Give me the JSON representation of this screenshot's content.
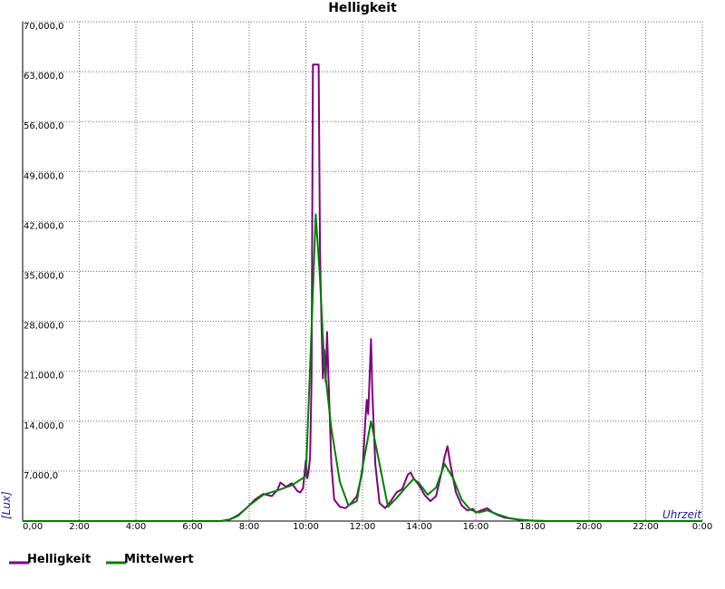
{
  "chart_data": {
    "type": "line",
    "title": "Helligkeit",
    "xlabel": "Uhrzeit",
    "ylabel": "[Lux]",
    "x_tick_labels": [
      "0,00",
      "2:00",
      "4:00",
      "6:00",
      "8:00",
      "10:00",
      "12:00",
      "14:00",
      "16:00",
      "18:00",
      "20:00",
      "22:00",
      "0:00"
    ],
    "y_tick_labels": [
      "7,000,0",
      "14,000,0",
      "21,000,0",
      "28,000,0",
      "35,000,0",
      "42,000,0",
      "49,000,0",
      "56,000,0",
      "63,000,0",
      "70,000,0"
    ],
    "xlim": [
      0,
      24
    ],
    "ylim": [
      0,
      70000
    ],
    "grid": true,
    "legend_position": "bottom-left",
    "series": [
      {
        "name": "Helligkeit",
        "color": "#800080",
        "points": [
          [
            0,
            0
          ],
          [
            7.0,
            0
          ],
          [
            7.3,
            200
          ],
          [
            7.6,
            800
          ],
          [
            7.9,
            1800
          ],
          [
            8.2,
            3000
          ],
          [
            8.5,
            3800
          ],
          [
            8.8,
            3500
          ],
          [
            9.0,
            4400
          ],
          [
            9.1,
            5400
          ],
          [
            9.3,
            4800
          ],
          [
            9.5,
            5300
          ],
          [
            9.7,
            4200
          ],
          [
            9.8,
            4000
          ],
          [
            9.9,
            4600
          ],
          [
            10.0,
            8500
          ],
          [
            10.05,
            6000
          ],
          [
            10.1,
            7000
          ],
          [
            10.15,
            9000
          ],
          [
            10.2,
            20000
          ],
          [
            10.25,
            64000
          ],
          [
            10.35,
            64000
          ],
          [
            10.45,
            64000
          ],
          [
            10.5,
            38000
          ],
          [
            10.55,
            28000
          ],
          [
            10.6,
            20000
          ],
          [
            10.65,
            24000
          ],
          [
            10.7,
            19500
          ],
          [
            10.75,
            26500
          ],
          [
            10.8,
            20000
          ],
          [
            10.9,
            8000
          ],
          [
            11.0,
            3000
          ],
          [
            11.2,
            2000
          ],
          [
            11.4,
            1800
          ],
          [
            11.6,
            2500
          ],
          [
            11.8,
            3500
          ],
          [
            12.0,
            7000
          ],
          [
            12.1,
            14000
          ],
          [
            12.15,
            17000
          ],
          [
            12.2,
            15000
          ],
          [
            12.25,
            20000
          ],
          [
            12.3,
            25500
          ],
          [
            12.35,
            18000
          ],
          [
            12.45,
            8000
          ],
          [
            12.6,
            2500
          ],
          [
            12.8,
            1800
          ],
          [
            13.0,
            2800
          ],
          [
            13.2,
            4000
          ],
          [
            13.4,
            4500
          ],
          [
            13.6,
            6500
          ],
          [
            13.7,
            6800
          ],
          [
            13.8,
            6000
          ],
          [
            14.0,
            5000
          ],
          [
            14.2,
            3600
          ],
          [
            14.4,
            2800
          ],
          [
            14.6,
            3500
          ],
          [
            14.8,
            7000
          ],
          [
            14.9,
            9000
          ],
          [
            15.0,
            10500
          ],
          [
            15.1,
            8000
          ],
          [
            15.3,
            4000
          ],
          [
            15.5,
            2200
          ],
          [
            15.7,
            1500
          ],
          [
            15.9,
            1700
          ],
          [
            16.0,
            1200
          ],
          [
            16.2,
            1500
          ],
          [
            16.4,
            1800
          ],
          [
            16.6,
            1200
          ],
          [
            16.8,
            800
          ],
          [
            17.0,
            500
          ],
          [
            17.5,
            200
          ],
          [
            18.0,
            50
          ],
          [
            18.5,
            0
          ],
          [
            24,
            0
          ]
        ]
      },
      {
        "name": "Mittelwert",
        "color": "#008000",
        "points": [
          [
            0,
            0
          ],
          [
            7.0,
            0
          ],
          [
            7.3,
            200
          ],
          [
            7.6,
            700
          ],
          [
            8.0,
            2200
          ],
          [
            8.5,
            3700
          ],
          [
            9.0,
            4300
          ],
          [
            9.5,
            5000
          ],
          [
            10.0,
            6300
          ],
          [
            10.2,
            27000
          ],
          [
            10.35,
            43000
          ],
          [
            10.5,
            34000
          ],
          [
            10.65,
            22000
          ],
          [
            10.9,
            13000
          ],
          [
            11.2,
            5500
          ],
          [
            11.5,
            2200
          ],
          [
            11.8,
            2800
          ],
          [
            12.0,
            7500
          ],
          [
            12.3,
            14000
          ],
          [
            12.6,
            8000
          ],
          [
            12.9,
            2000
          ],
          [
            13.2,
            3200
          ],
          [
            13.5,
            4600
          ],
          [
            13.8,
            5900
          ],
          [
            14.0,
            5300
          ],
          [
            14.3,
            3700
          ],
          [
            14.6,
            4700
          ],
          [
            14.9,
            8000
          ],
          [
            15.2,
            6000
          ],
          [
            15.5,
            3000
          ],
          [
            15.8,
            1600
          ],
          [
            16.1,
            1200
          ],
          [
            16.4,
            1500
          ],
          [
            16.8,
            900
          ],
          [
            17.2,
            400
          ],
          [
            17.6,
            150
          ],
          [
            18.0,
            50
          ],
          [
            18.5,
            0
          ],
          [
            24,
            0
          ]
        ]
      }
    ]
  }
}
